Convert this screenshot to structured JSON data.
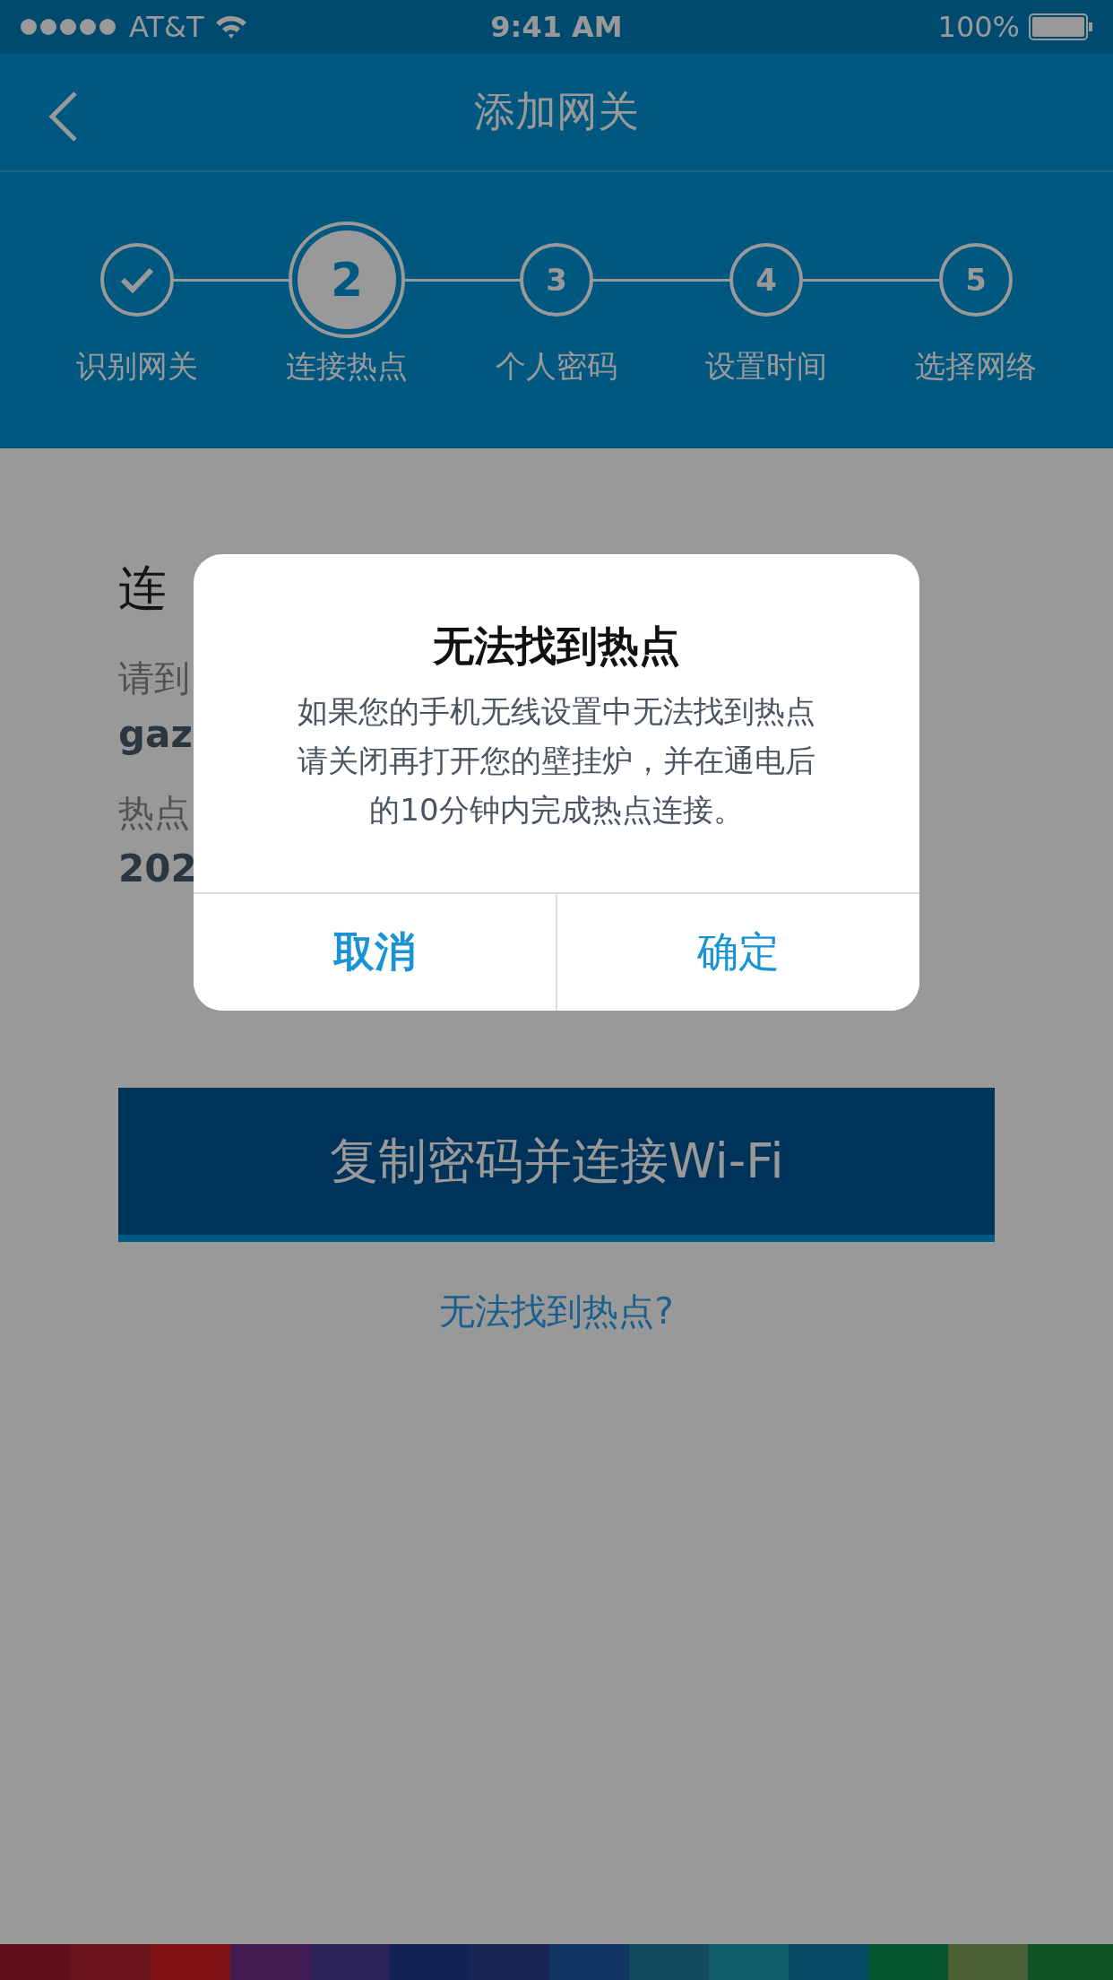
{
  "status_bar": {
    "carrier": "AT&T",
    "time": "9:41 AM",
    "battery": "100%"
  },
  "nav": {
    "title": "添加网关"
  },
  "steps": [
    {
      "label": "识别网关",
      "kind": "done"
    },
    {
      "label": "连接热点",
      "number": "2",
      "kind": "active"
    },
    {
      "label": "个人密码",
      "number": "3",
      "kind": "pending"
    },
    {
      "label": "设置时间",
      "number": "4",
      "kind": "pending"
    },
    {
      "label": "选择网络",
      "number": "5",
      "kind": "pending"
    }
  ],
  "content": {
    "heading": "连",
    "instruction": "请到",
    "ssid": "gaz",
    "password_label": "热点",
    "password": "202"
  },
  "primary_button": "复制密码并连接Wi-Fi",
  "help_link": "无法找到热点?",
  "dialog": {
    "title": "无法找到热点",
    "message": [
      "如果您的手机无线设置中无法找到热点",
      "请关闭再打开您的壁挂炉，并在通电后",
      "的10分钟内完成热点连接。"
    ],
    "buttons": [
      {
        "label": "取消",
        "kind": "cancel"
      },
      {
        "label": "确定",
        "kind": "confirm"
      }
    ]
  },
  "overlay": {
    "dimmed": true
  }
}
